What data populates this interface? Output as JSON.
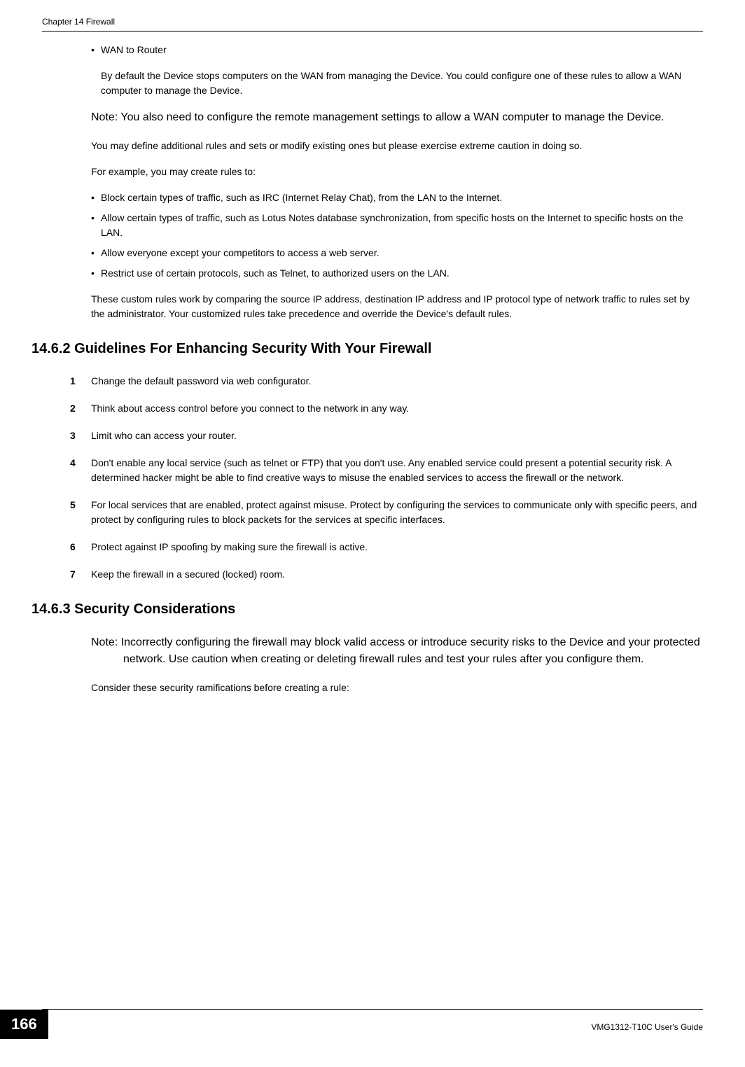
{
  "header": {
    "chapter": "Chapter 14 Firewall"
  },
  "content": {
    "wan_bullet": "WAN to Router",
    "wan_para": "By default the Device stops computers on the WAN from managing the Device. You could configure one of these rules to allow a WAN computer to manage the Device.",
    "note1": "Note: You also need to configure the remote management settings to allow a WAN computer to manage the Device.",
    "para1": "You may define additional rules and sets or modify existing ones but please exercise extreme caution in doing so.",
    "para2": "For example, you may create rules to:",
    "examples": [
      "Block certain types of traffic, such as IRC (Internet Relay Chat), from the LAN to the Internet.",
      "Allow certain types of traffic, such as Lotus Notes database synchronization, from specific hosts on the Internet to specific hosts on the LAN.",
      "Allow everyone except your competitors to access a web server.",
      "Restrict use of certain protocols, such as Telnet, to authorized users on the LAN."
    ],
    "para3": "These custom rules work by comparing the source IP address, destination IP address and IP protocol type of network traffic to rules set by the administrator. Your customized rules take precedence and override the Device's default rules.",
    "heading1": "14.6.2  Guidelines For Enhancing Security With Your Firewall",
    "guidelines": [
      "Change the default password via web configurator.",
      "Think about access control before you connect to the network in any way.",
      "Limit who can access your router.",
      "Don't enable any local service (such as telnet or FTP) that you don't use. Any enabled service could present a potential security risk. A determined hacker might be able to find creative ways to misuse the enabled services to access the firewall or the network.",
      "For local services that are enabled, protect against misuse. Protect by configuring the services to communicate only with specific peers, and protect by configuring rules to block packets for the services at specific interfaces.",
      "Protect against IP spoofing by making sure the firewall is active.",
      "Keep the firewall in a secured (locked) room."
    ],
    "heading2": "14.6.3  Security Considerations",
    "note2": "Note: Incorrectly configuring the firewall may block valid access or introduce security risks to the Device and your protected network. Use caution when creating or deleting firewall rules and test your rules after you configure them.",
    "para4": "Consider these security ramifications before creating a rule:"
  },
  "footer": {
    "page_number": "166",
    "guide": "VMG1312-T10C User's Guide"
  }
}
